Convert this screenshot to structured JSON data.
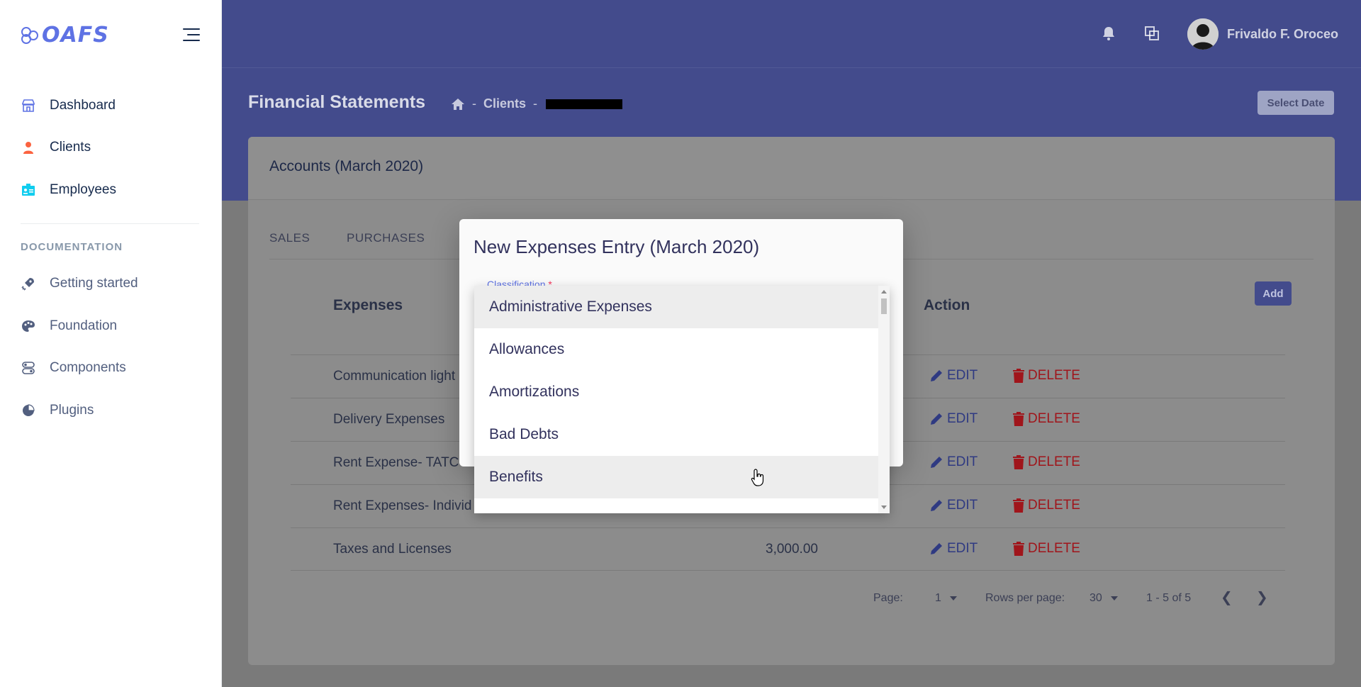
{
  "brand": {
    "name": "OAFS"
  },
  "sidebar": {
    "items": [
      {
        "label": "Dashboard",
        "icon": "store-icon",
        "color": "#5e72e4"
      },
      {
        "label": "Clients",
        "icon": "person-icon",
        "color": "#fb6340"
      },
      {
        "label": "Employees",
        "icon": "id-card-icon",
        "color": "#11cdef"
      }
    ],
    "doc_heading": "DOCUMENTATION",
    "doc_items": [
      {
        "label": "Getting started",
        "icon": "rocket-icon"
      },
      {
        "label": "Foundation",
        "icon": "palette-icon"
      },
      {
        "label": "Components",
        "icon": "ui-components-icon"
      },
      {
        "label": "Plugins",
        "icon": "pie-chart-icon"
      }
    ]
  },
  "topbar": {
    "user_name": "Frivaldo F. Oroceo"
  },
  "header": {
    "title": "Financial Statements",
    "breadcrumb": [
      "Clients"
    ],
    "select_date_label": "Select Date"
  },
  "card": {
    "title": "Accounts (March 2020)",
    "tabs": [
      "SALES",
      "PURCHASES"
    ],
    "add_label": "Add",
    "columns": {
      "expenses": "Expenses",
      "action": "Action"
    },
    "rows": [
      {
        "name": "Communication light",
        "amount": ""
      },
      {
        "name": "Delivery Expenses",
        "amount": ""
      },
      {
        "name": "Rent Expense- TATC",
        "amount": ""
      },
      {
        "name": "Rent Expenses- Individ",
        "amount": ""
      },
      {
        "name": "Taxes and Licenses",
        "amount": "3,000.00"
      }
    ],
    "edit_label": "EDIT",
    "delete_label": "DELETE",
    "footer": {
      "page_label": "Page:",
      "page_value": "1",
      "rows_label": "Rows per page:",
      "rows_value": "30",
      "range": "1 - 5 of 5"
    }
  },
  "modal": {
    "title": "New Expenses Entry (March 2020)",
    "field_label": "Classification",
    "required_mark": "*",
    "options": [
      "Administrative Expenses",
      "Allowances",
      "Amortizations",
      "Bad Debts",
      "Benefits"
    ]
  },
  "colors": {
    "accent": "#5e72e4",
    "header": "#434b8c",
    "danger": "#f5365c"
  }
}
